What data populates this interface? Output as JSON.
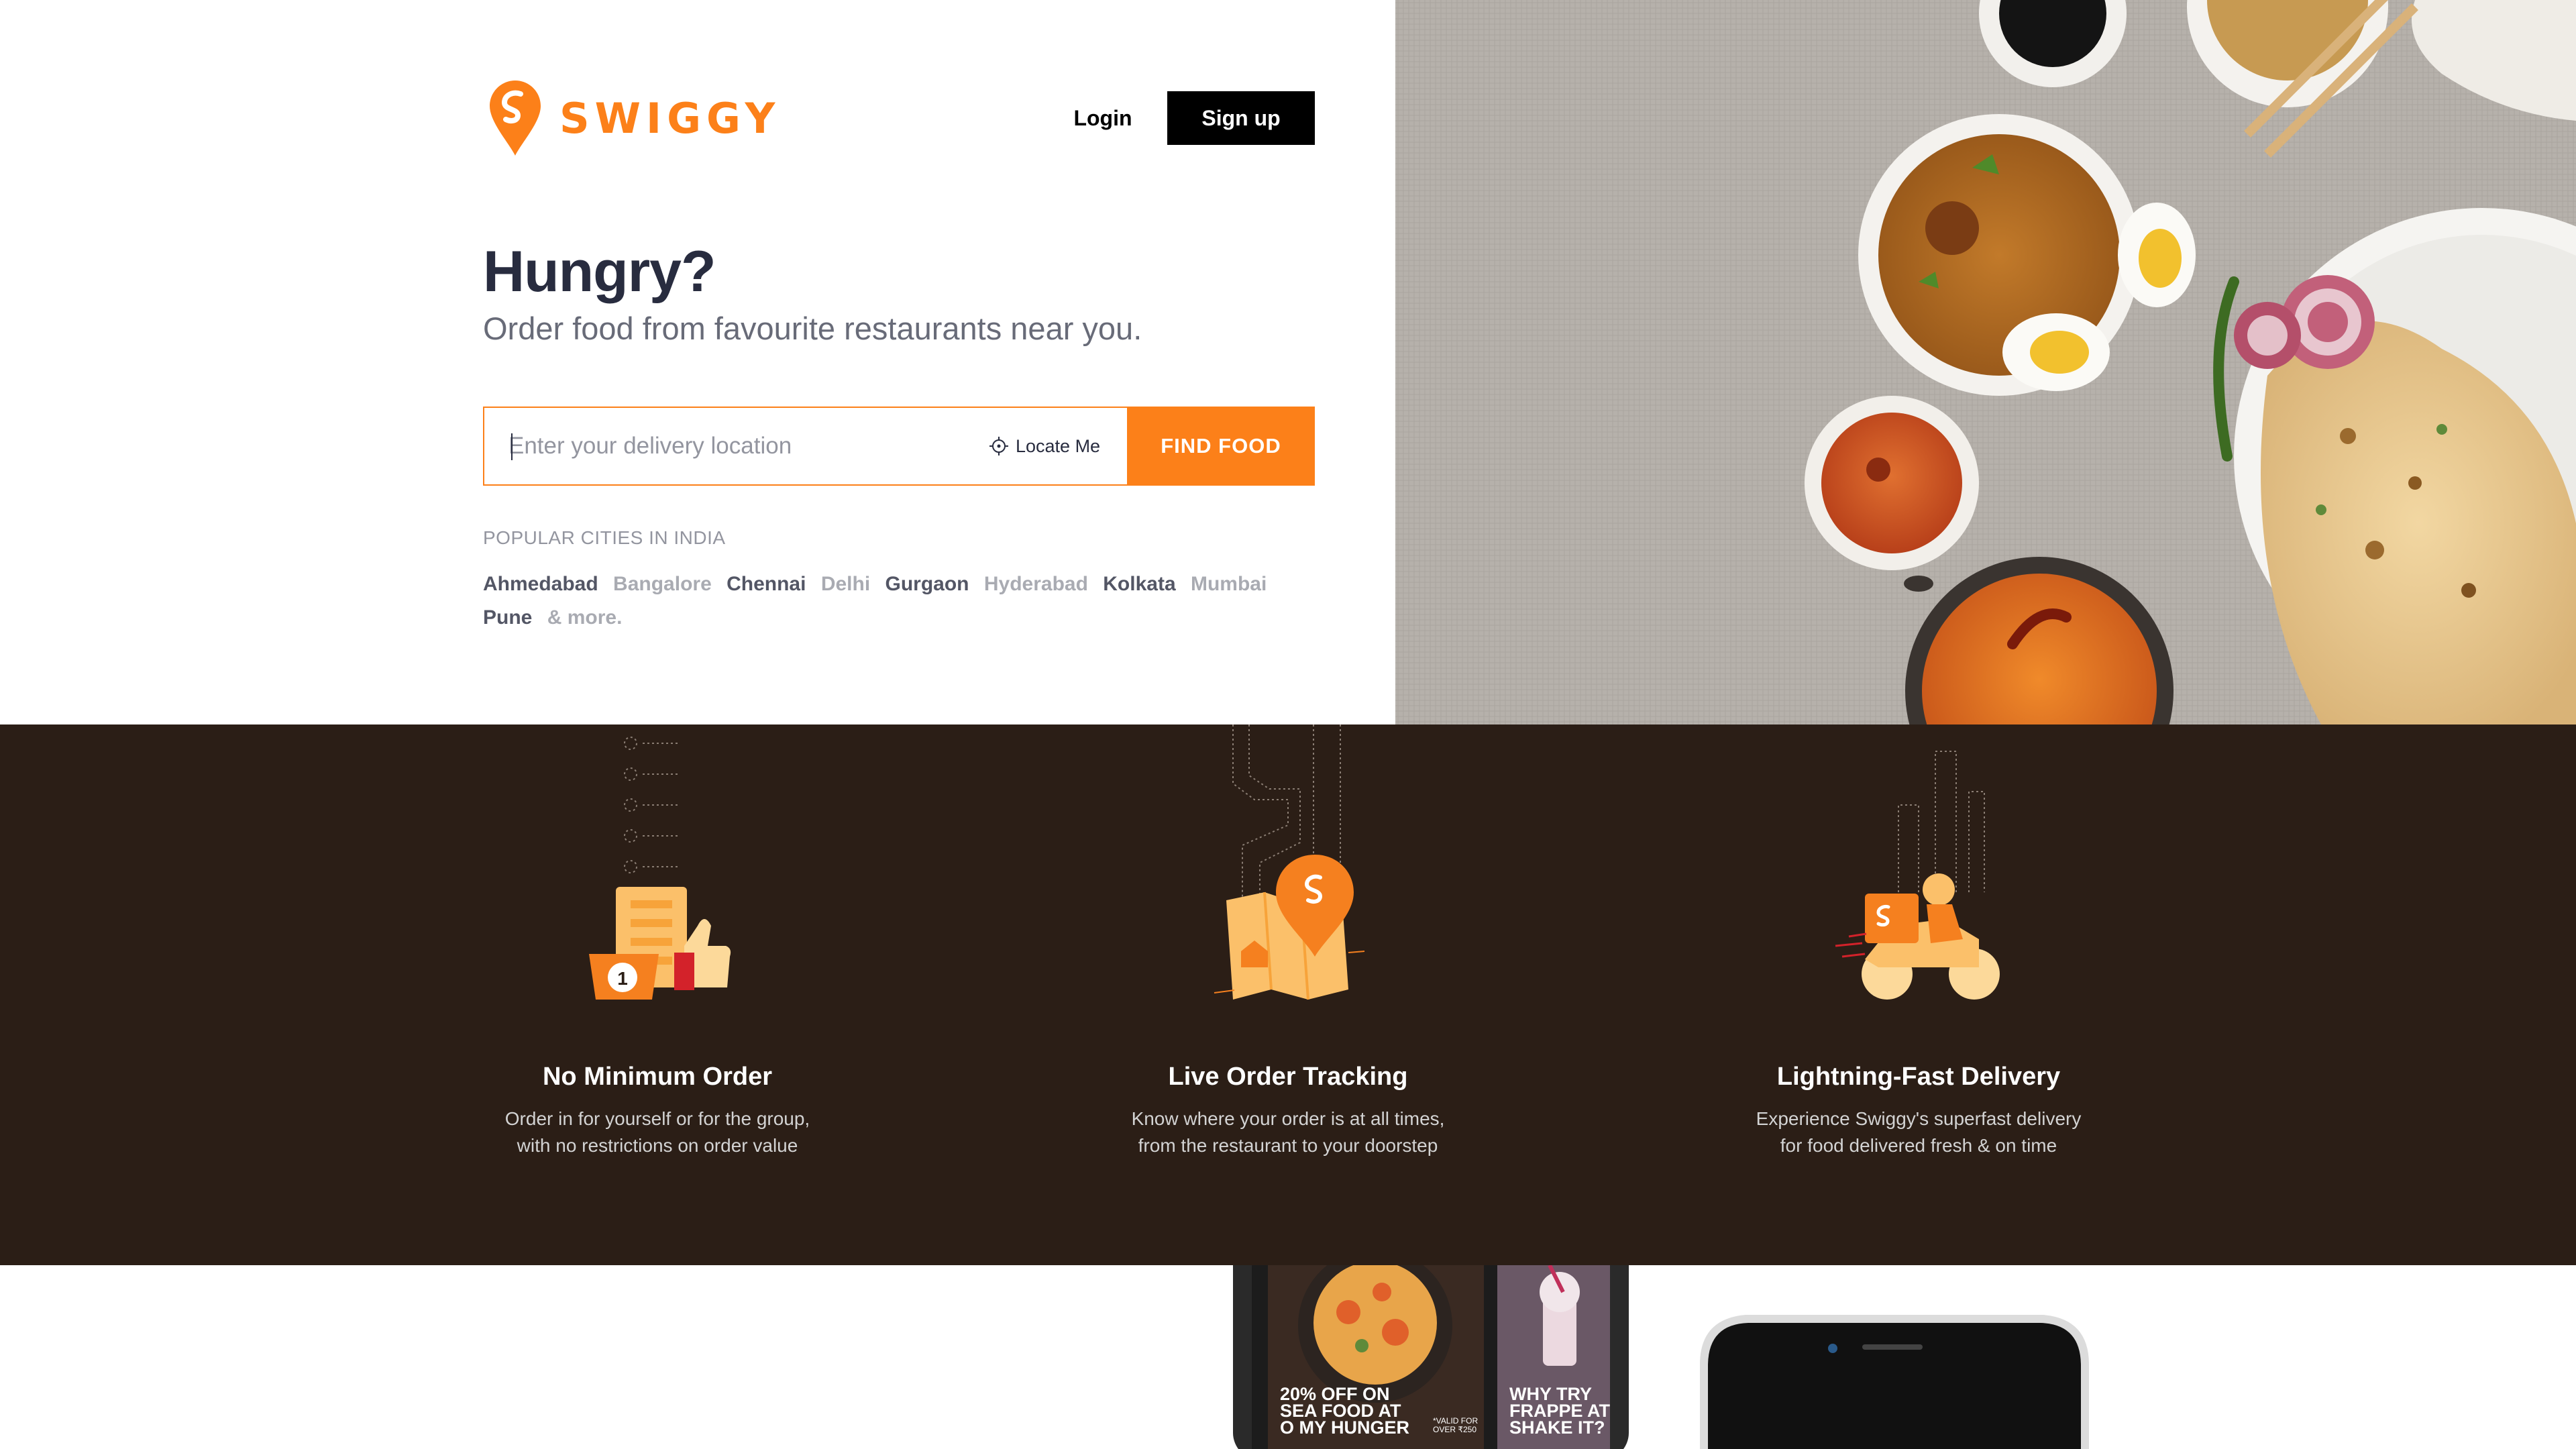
{
  "brand": {
    "name": "SWIGGY",
    "color": "#fc8019"
  },
  "header": {
    "login_label": "Login",
    "signup_label": "Sign up"
  },
  "hero": {
    "title": "Hungry?",
    "subtitle": "Order food from favourite restaurants near you.",
    "search": {
      "placeholder": "Enter your delivery location",
      "value": "",
      "locate_label": "Locate Me",
      "button_label": "FIND FOOD"
    },
    "popular": {
      "label": "POPULAR CITIES IN INDIA",
      "cities": [
        "Ahmedabad",
        "Bangalore",
        "Chennai",
        "Delhi",
        "Gurgaon",
        "Hyderabad",
        "Kolkata",
        "Mumbai",
        "Pune"
      ],
      "more_label": "& more."
    }
  },
  "features": [
    {
      "title": "No Minimum Order",
      "desc_line1": "Order in for yourself or for the group,",
      "desc_line2": "with no restrictions on order value",
      "icon": "thumbs-up-order-icon"
    },
    {
      "title": "Live Order Tracking",
      "desc_line1": "Know where your order is at all times,",
      "desc_line2": "from the restaurant to your doorstep",
      "icon": "map-pin-tracking-icon"
    },
    {
      "title": "Lightning-Fast Delivery",
      "desc_line1": "Experience Swiggy's superfast delivery",
      "desc_line2": "for food delivered fresh & on time",
      "icon": "delivery-scooter-icon"
    }
  ],
  "promos": [
    {
      "line1": "20% OFF ON",
      "line2": "SEA FOOD AT",
      "line3": "O MY HUNGER",
      "fine_print_1": "*VALID FOR",
      "fine_print_2": "OVER ₹250"
    },
    {
      "line1": "WHY TRY",
      "line2": "FRAPPE AT",
      "line3": "SHAKE IT?"
    }
  ],
  "colors": {
    "accent": "#fc8019",
    "features_bg": "#2b1e16",
    "text_dark": "#282c3f",
    "text_muted": "#686b78"
  }
}
